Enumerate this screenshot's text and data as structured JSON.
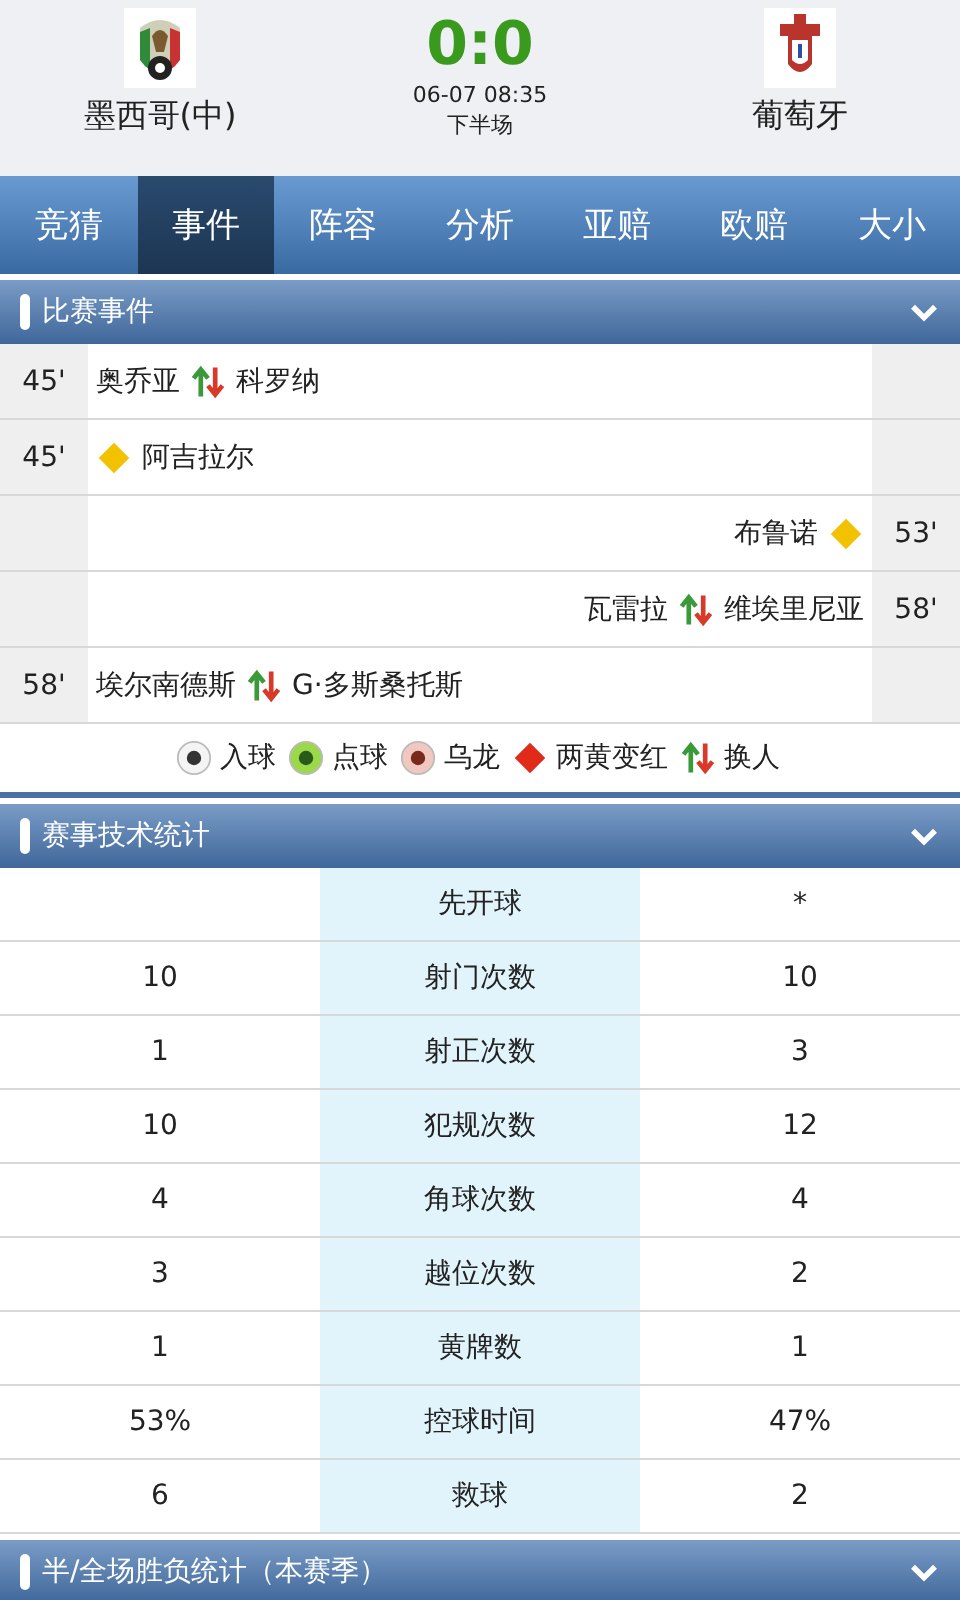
{
  "match": {
    "home": "墨西哥(中)",
    "away": "葡萄牙",
    "score": "0:0",
    "datetime": "06-07 08:35",
    "period": "下半场"
  },
  "tabs": [
    {
      "label": "竞猜",
      "selected": false
    },
    {
      "label": "事件",
      "selected": true
    },
    {
      "label": "阵容",
      "selected": false
    },
    {
      "label": "分析",
      "selected": false
    },
    {
      "label": "亚赔",
      "selected": false
    },
    {
      "label": "欧赔",
      "selected": false
    },
    {
      "label": "大小",
      "selected": false
    }
  ],
  "events_section": {
    "title": "比赛事件",
    "expanded": true
  },
  "events": [
    {
      "home": {
        "kind": "sub",
        "minute": "45'",
        "player_a": "奥乔亚",
        "player_b": "科罗纳"
      }
    },
    {
      "home": {
        "kind": "yellow",
        "minute": "45'",
        "player_a": "阿吉拉尔"
      }
    },
    {
      "away": {
        "kind": "yellow",
        "minute": "53'",
        "player_a": "布鲁诺"
      }
    },
    {
      "away": {
        "kind": "sub",
        "minute": "58'",
        "player_a": "瓦雷拉",
        "player_b": "维埃里尼亚"
      }
    },
    {
      "home": {
        "kind": "sub",
        "minute": "58'",
        "player_a": "埃尔南德斯",
        "player_b": "G·多斯桑托斯"
      }
    }
  ],
  "legend": [
    {
      "kind": "goal",
      "label": "入球"
    },
    {
      "kind": "penalty",
      "label": "点球"
    },
    {
      "kind": "own_goal",
      "label": "乌龙"
    },
    {
      "kind": "second_yellow",
      "label": "两黄变红"
    },
    {
      "kind": "sub",
      "label": "换人"
    }
  ],
  "stats_section": {
    "title": "赛事技术统计",
    "expanded": true
  },
  "stats": [
    {
      "name": "先开球",
      "away": "*"
    },
    {
      "home": "10",
      "name": "射门次数",
      "away": "10"
    },
    {
      "home": "1",
      "name": "射正次数",
      "away": "3"
    },
    {
      "home": "10",
      "name": "犯规次数",
      "away": "12"
    },
    {
      "home": "4",
      "name": "角球次数",
      "away": "4"
    },
    {
      "home": "3",
      "name": "越位次数",
      "away": "2"
    },
    {
      "home": "1",
      "name": "黄牌数",
      "away": "1"
    },
    {
      "home": "53%",
      "name": "控球时间",
      "away": "47%"
    },
    {
      "home": "6",
      "name": "救球",
      "away": "2"
    }
  ],
  "season_section": {
    "title": "半/全场胜负统计（本赛季）",
    "expanded": true
  }
}
